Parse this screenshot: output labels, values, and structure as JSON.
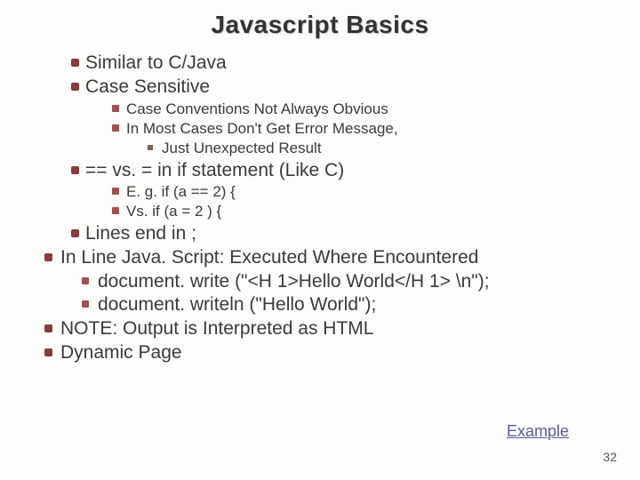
{
  "title": "Javascript Basics",
  "bullets": {
    "similar": "Similar to C/Java",
    "case_sensitive": "Case Sensitive",
    "case_sub1": "Case Conventions  Not Always Obvious",
    "case_sub2": "In Most Cases Don't Get Error Message,",
    "case_sub2b": "Just Unexpected Result",
    "eq": "== vs. = in if statement (Like C)",
    "eq_sub1": "E. g. if (a == 2) {",
    "eq_sub2": "Vs.  if (a = 2 ) {",
    "lines_end": "Lines end in ;",
    "inline": "In Line Java. Script: Executed Where Encountered",
    "doc1": "document. write (\"<H 1>Hello World</H 1> \\n\");",
    "doc2": "document. writeln (\"Hello World\");",
    "note": "NOTE: Output is Interpreted as HTML",
    "dynamic": "Dynamic Page"
  },
  "link_label": "Example",
  "page_number": "32"
}
